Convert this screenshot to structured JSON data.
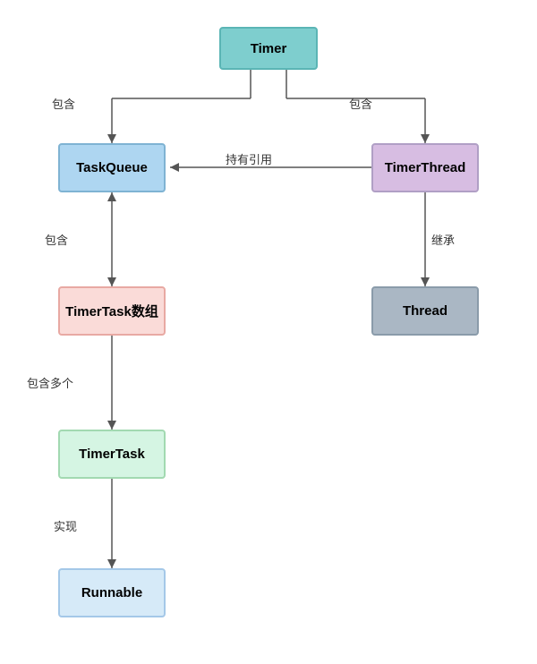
{
  "nodes": {
    "timer": {
      "label": "Timer"
    },
    "taskqueue": {
      "label": "TaskQueue"
    },
    "timerthread": {
      "label": "TimerThread"
    },
    "timertask_arr": {
      "label": "TimerTask数组"
    },
    "thread": {
      "label": "Thread"
    },
    "timertask": {
      "label": "TimerTask"
    },
    "runnable": {
      "label": "Runnable"
    }
  },
  "edge_labels": {
    "timer_to_taskqueue": "包含",
    "timer_to_timerthread": "包含",
    "timerthread_to_taskqueue": "持有引用",
    "timerthread_to_thread": "继承",
    "taskqueue_to_timertask_arr": "包含",
    "timertask_arr_to_timertask": "包含多个",
    "timertask_to_runnable": "实现"
  }
}
